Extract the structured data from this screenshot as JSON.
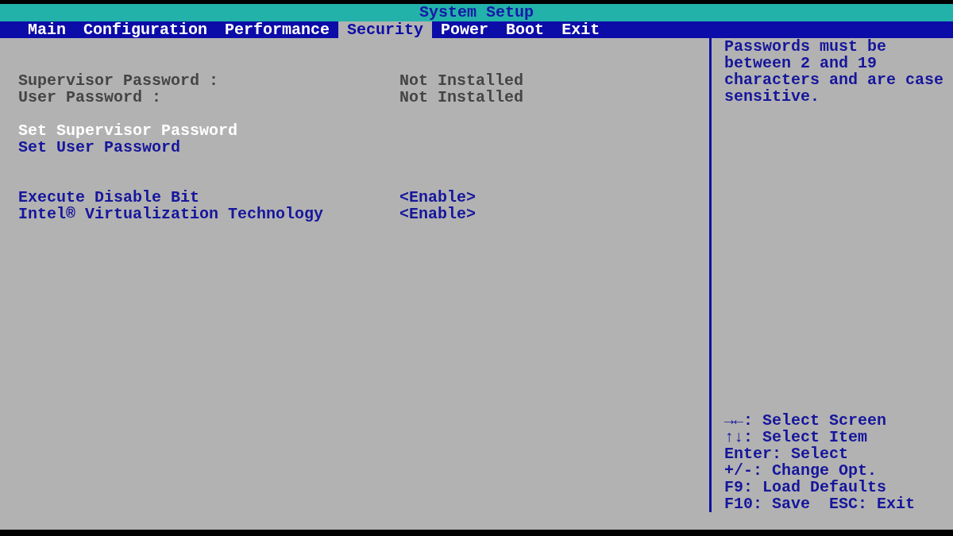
{
  "window": {
    "title": "System Setup"
  },
  "tabs": [
    {
      "label": "Main",
      "selected": false
    },
    {
      "label": "Configuration",
      "selected": false
    },
    {
      "label": "Performance",
      "selected": false
    },
    {
      "label": "Security",
      "selected": true
    },
    {
      "label": "Power",
      "selected": false
    },
    {
      "label": "Boot",
      "selected": false
    },
    {
      "label": "Exit",
      "selected": false
    }
  ],
  "groups": [
    {
      "items": [
        {
          "kind": "info",
          "label": "Supervisor Password :",
          "value": "Not Installed",
          "selected": false
        },
        {
          "kind": "info",
          "label": "User Password :",
          "value": "Not Installed",
          "selected": false
        }
      ]
    },
    {
      "items": [
        {
          "kind": "action",
          "label": "Set Supervisor Password",
          "selected": true
        },
        {
          "kind": "action",
          "label": "Set User Password",
          "selected": false
        }
      ]
    },
    {
      "items": [
        {
          "kind": "option",
          "label": "Execute Disable Bit",
          "value": "<Enable>",
          "selected": false
        },
        {
          "kind": "option",
          "label": "Intel® Virtualization Technology",
          "value": "<Enable>",
          "selected": false
        }
      ]
    }
  ],
  "help": {
    "text": "Passwords must be between 2 and 19 characters and are case sensitive.",
    "keys": [
      "→←: Select Screen",
      "↑↓: Select Item",
      "Enter: Select",
      "+/-: Change Opt.",
      "F9: Load Defaults",
      "F10: Save  ESC: Exit"
    ]
  }
}
